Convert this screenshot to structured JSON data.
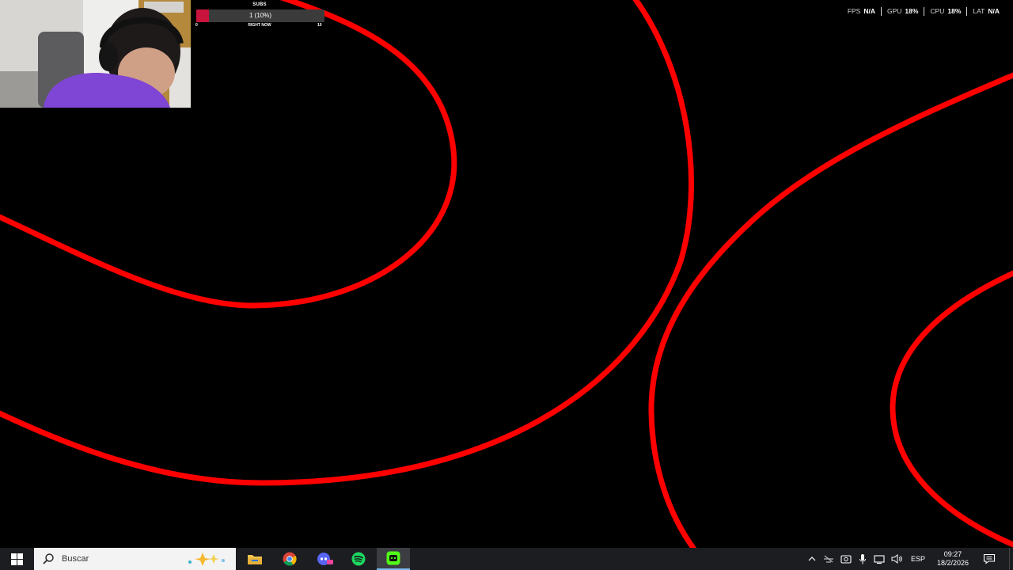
{
  "overlay": {
    "subs_goal": {
      "title": "SUBS",
      "value_text": "1 (10%)",
      "progress": 0.1,
      "min_label": "0",
      "max_label": "10",
      "caption": "RIGHT NOW"
    },
    "perf": [
      {
        "label": "FPS",
        "value": "N/A"
      },
      {
        "label": "GPU",
        "value": "18%"
      },
      {
        "label": "CPU",
        "value": "18%"
      },
      {
        "label": "LAT",
        "value": "N/A"
      }
    ]
  },
  "wallpaper": {
    "background_color": "#000000",
    "stroke_color": "#ff0000"
  },
  "taskbar": {
    "search_placeholder": "Buscar",
    "apps": [
      {
        "name": "file-explorer",
        "icon": "folder-icon"
      },
      {
        "name": "chrome",
        "icon": "chrome-icon"
      },
      {
        "name": "discord-ptb",
        "icon": "discord-icon"
      },
      {
        "name": "spotify",
        "icon": "spotify-icon"
      },
      {
        "name": "streaming-app",
        "icon": "app-icon",
        "active": true
      }
    ],
    "tray": {
      "language": "ESP",
      "time": "09:27",
      "date": "18/2/2026"
    },
    "colors": {
      "taskbar_bg": "#1c1d21",
      "accent": "#76b9ed"
    }
  }
}
